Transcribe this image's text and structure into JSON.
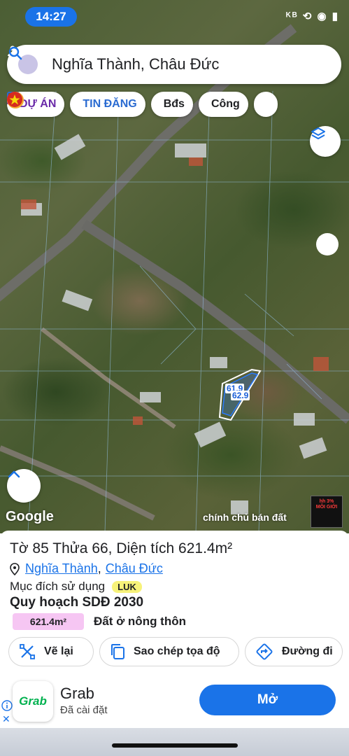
{
  "status_bar": {
    "time": "14:27",
    "icons": "ᴷᴮ ⟲ ◉ ▮"
  },
  "search": {
    "query": "Nghĩa Thành, Châu Đức"
  },
  "chips": [
    {
      "label": "DỰ ÁN"
    },
    {
      "label": "TIN ĐĂNG"
    },
    {
      "label": "Bđs"
    },
    {
      "label": "Công"
    }
  ],
  "map": {
    "google_label": "Google",
    "watermark": "chính chủ bán đất",
    "lot_labels": [
      "61.9",
      "62.9"
    ],
    "ad_thumb": {
      "line1": "hh 3%",
      "line2": "MÔI GIỚI"
    }
  },
  "panel": {
    "title": "Tờ 85 Thửa 66, Diện tích 621.4m²",
    "location": {
      "commune": "Nghĩa Thành",
      "district": "Châu Đức"
    },
    "purpose_label": "Mục đích sử dụng",
    "purpose_code": "LUK",
    "plan_title": "Quy hoạch SDĐ 2030",
    "area_value": "621.4m²",
    "area_desc": "Đất ở nông thôn",
    "actions": {
      "redraw": "Vẽ lại",
      "copy_coords": "Sao chép tọa độ",
      "directions": "Đường đi"
    }
  },
  "ad": {
    "logo_text": "Grab",
    "name": "Grab",
    "subtitle": "Đã cài đặt",
    "button": "Mở"
  },
  "colors": {
    "accent": "#1a73e8",
    "chip_purple": "#6a2aa8",
    "luk_badge": "#f7f27a",
    "area_badge": "#f6c6f3",
    "grab_green": "#00b14f"
  }
}
